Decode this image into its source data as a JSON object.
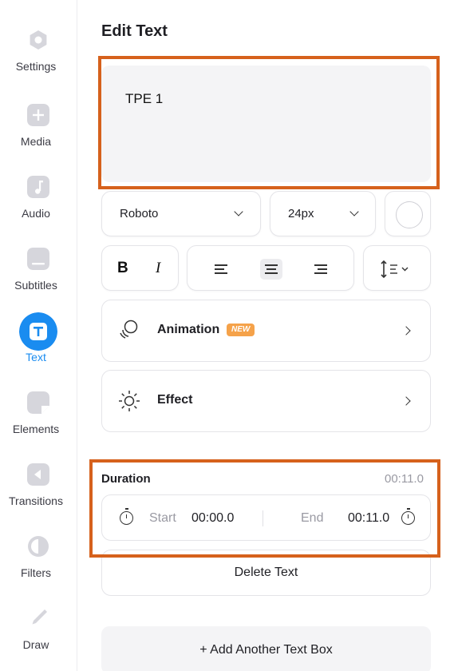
{
  "sidebar": {
    "items": [
      {
        "label": "Settings",
        "icon": "settings-icon"
      },
      {
        "label": "Media",
        "icon": "plus-icon"
      },
      {
        "label": "Audio",
        "icon": "music-note-icon"
      },
      {
        "label": "Subtitles",
        "icon": "subtitles-icon"
      },
      {
        "label": "Text",
        "icon": "text-icon",
        "active": true
      },
      {
        "label": "Elements",
        "icon": "elements-icon"
      },
      {
        "label": "Transitions",
        "icon": "transitions-icon"
      },
      {
        "label": "Filters",
        "icon": "filters-icon"
      },
      {
        "label": "Draw",
        "icon": "pencil-icon"
      }
    ]
  },
  "panel": {
    "title": "Edit Text",
    "text_value": "TPE 1"
  },
  "font": {
    "family": "Roboto",
    "size": "24px",
    "color": "#ffffff"
  },
  "format": {
    "bold": "B",
    "italic": "I",
    "alignment_selected": "center"
  },
  "animation": {
    "label": "Animation",
    "badge": "NEW"
  },
  "effect": {
    "label": "Effect"
  },
  "duration": {
    "title": "Duration",
    "total": "00:11.0",
    "start_label": "Start",
    "start_value": "00:00.0",
    "end_label": "End",
    "end_value": "00:11.0"
  },
  "actions": {
    "delete": "Delete Text",
    "add": "+  Add Another Text Box"
  },
  "colors": {
    "accent": "#1a8cf0",
    "highlight": "#d6611c",
    "badge": "#f5a24a"
  }
}
